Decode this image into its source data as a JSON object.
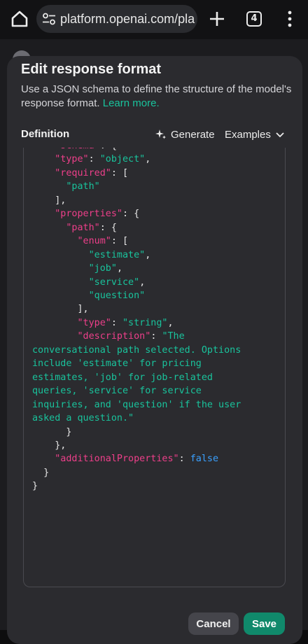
{
  "browser": {
    "url": "platform.openai.com/pla",
    "tab_count": "4",
    "icons": [
      "home-icon",
      "site-settings-icon",
      "new-tab-plus-icon",
      "tab-switcher-icon",
      "overflow-menu-icon"
    ]
  },
  "modal": {
    "title": "Edit response format",
    "description": "Use a JSON schema to define the structure of the model's response format.",
    "learn_more": "Learn more.",
    "definition_label": "Definition",
    "generate_label": "Generate",
    "examples_label": "Examples",
    "cancel_label": "Cancel",
    "save_label": "Save"
  },
  "editor": {
    "lines": [
      [
        {
          "t": "    "
        },
        {
          "t": "\"schema\"",
          "c": "k"
        },
        {
          "t": ": {"
        }
      ],
      [
        {
          "t": "    "
        },
        {
          "t": "\"type\"",
          "c": "k"
        },
        {
          "t": ": "
        },
        {
          "t": "\"object\"",
          "c": "s"
        },
        {
          "t": ","
        }
      ],
      [
        {
          "t": "    "
        },
        {
          "t": "\"required\"",
          "c": "k"
        },
        {
          "t": ": ["
        }
      ],
      [
        {
          "t": "      "
        },
        {
          "t": "\"path\"",
          "c": "s"
        }
      ],
      [
        {
          "t": "    ],"
        }
      ],
      [
        {
          "t": "    "
        },
        {
          "t": "\"properties\"",
          "c": "k"
        },
        {
          "t": ": {"
        }
      ],
      [
        {
          "t": "      "
        },
        {
          "t": "\"path\"",
          "c": "k"
        },
        {
          "t": ": {"
        }
      ],
      [
        {
          "t": "        "
        },
        {
          "t": "\"enum\"",
          "c": "k"
        },
        {
          "t": ": ["
        }
      ],
      [
        {
          "t": "          "
        },
        {
          "t": "\"estimate\"",
          "c": "s"
        },
        {
          "t": ","
        }
      ],
      [
        {
          "t": "          "
        },
        {
          "t": "\"job\"",
          "c": "s"
        },
        {
          "t": ","
        }
      ],
      [
        {
          "t": "          "
        },
        {
          "t": "\"service\"",
          "c": "s"
        },
        {
          "t": ","
        }
      ],
      [
        {
          "t": "          "
        },
        {
          "t": "\"question\"",
          "c": "s"
        }
      ],
      [
        {
          "t": "        ],"
        }
      ],
      [
        {
          "t": "        "
        },
        {
          "t": "\"type\"",
          "c": "k"
        },
        {
          "t": ": "
        },
        {
          "t": "\"string\"",
          "c": "s"
        },
        {
          "t": ","
        }
      ],
      [
        {
          "t": "        "
        },
        {
          "t": "\"description\"",
          "c": "k"
        },
        {
          "t": ": "
        },
        {
          "t": "\"The",
          "c": "s"
        }
      ],
      [
        {
          "t": "conversational path selected. Options",
          "c": "s"
        }
      ],
      [
        {
          "t": "include 'estimate' for pricing",
          "c": "s"
        }
      ],
      [
        {
          "t": "estimates, 'job' for job-related",
          "c": "s"
        }
      ],
      [
        {
          "t": "queries, 'service' for service",
          "c": "s"
        }
      ],
      [
        {
          "t": "inquiries, and 'question' if the user",
          "c": "s"
        }
      ],
      [
        {
          "t": "asked a question.\"",
          "c": "s"
        }
      ],
      [
        {
          "t": "      }"
        }
      ],
      [
        {
          "t": "    },"
        }
      ],
      [
        {
          "t": "    "
        },
        {
          "t": "\"additionalProperties\"",
          "c": "k"
        },
        {
          "t": ": "
        },
        {
          "t": "false",
          "c": "b"
        }
      ],
      [
        {
          "t": "  }"
        }
      ],
      [
        {
          "t": "}"
        }
      ]
    ]
  },
  "colors": {
    "key": "#ee3f8a",
    "string": "#19c39c",
    "boolean": "#3aa0ff",
    "save_button": "#10896b",
    "link": "#19c39c"
  }
}
